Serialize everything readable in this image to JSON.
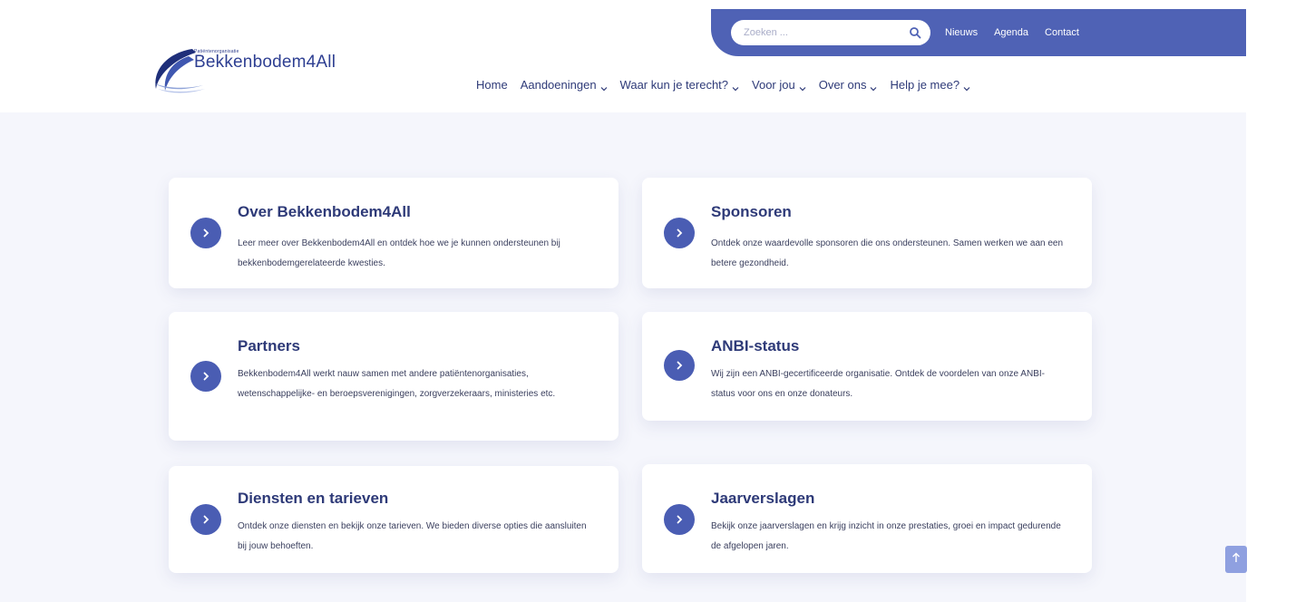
{
  "search": {
    "placeholder": "Zoeken ..."
  },
  "utility_links": [
    "Nieuws",
    "Agenda",
    "Contact"
  ],
  "logo": {
    "tagline": "Patiëntenorganisatie",
    "name": "Bekkenbodem4All"
  },
  "nav": [
    {
      "label": "Home",
      "has_dropdown": false
    },
    {
      "label": "Aandoeningen",
      "has_dropdown": true
    },
    {
      "label": "Waar kun je terecht?",
      "has_dropdown": true
    },
    {
      "label": "Voor jou",
      "has_dropdown": true
    },
    {
      "label": "Over ons",
      "has_dropdown": true
    },
    {
      "label": "Help je mee?",
      "has_dropdown": true
    }
  ],
  "cards": [
    {
      "title": "Over Bekkenbodem4All",
      "description": "Leer meer over Bekkenbodem4All en ontdek hoe we je kunnen ondersteunen bij bekkenbodemgerelateerde kwesties."
    },
    {
      "title": "Sponsoren",
      "description": "Ontdek onze waardevolle sponsoren die ons ondersteunen. Samen werken we aan een betere gezondheid."
    },
    {
      "title": "Partners",
      "description": "Bekkenbodem4All werkt nauw samen met andere patiëntenorganisaties, wetenschappelijke- en beroepsverenigingen, zorgverzekeraars, ministeries etc."
    },
    {
      "title": "ANBI-status",
      "description": "Wij zijn een ANBI-gecertificeerde organisatie. Ontdek de voordelen van onze ANBI-status voor ons en onze donateurs."
    },
    {
      "title": "Diensten en tarieven",
      "description": "Ontdek onze diensten en bekijk onze tarieven. We bieden diverse opties die aansluiten bij jouw behoeften."
    },
    {
      "title": "Jaarverslagen",
      "description": "Bekijk onze jaarverslagen en krijg inzicht in onze prestaties, groei en impact gedurende de afgelopen jaren."
    }
  ],
  "colors": {
    "accent": "#4f62b5",
    "heading": "#2e3a78",
    "background": "#f5f6fc"
  },
  "icons": {
    "search": "search-icon",
    "card_arrow": "chevron-right-icon",
    "scroll_top": "arrow-up-icon"
  }
}
